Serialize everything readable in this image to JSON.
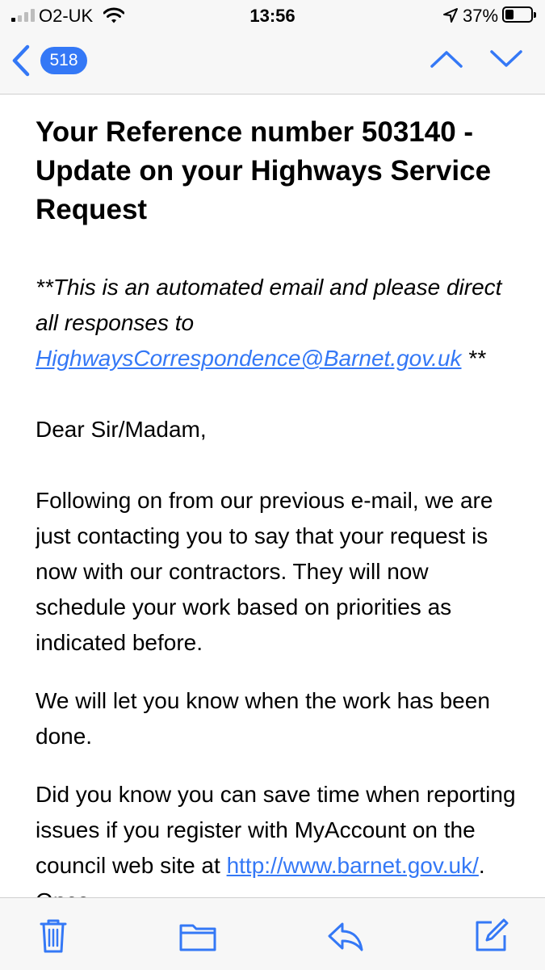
{
  "status_bar": {
    "carrier": "O2-UK",
    "time": "13:56",
    "battery_percent": "37%",
    "signal_bars_active": 1,
    "signal_bars_total": 4,
    "battery_level": 0.37
  },
  "nav": {
    "back_count": "518"
  },
  "email": {
    "subject": "Your Reference number 503140 - Update on your Highways Service Request",
    "notice_prefix": "**This is an automated email and please direct all responses to ",
    "notice_link": "HighwaysCorrespondence@Barnet.gov.uk",
    "notice_suffix": " **",
    "salutation": "Dear Sir/Madam,",
    "paragraph1": "Following on from our previous e-mail, we are just contacting you to say that your request is now with our contractors. They will now schedule your work based on priorities as indicated before.",
    "paragraph2": "We will let you know when the work has been done.",
    "paragraph3_text": "Did you know you can save time when reporting issues if you register with MyAccount on the council web site at ",
    "paragraph3_link": "http://www.barnet.gov.uk/",
    "paragraph3_suffix": ". Once"
  },
  "colors": {
    "accent": "#3478f6",
    "bar_background": "#f7f7f7"
  },
  "toolbar": {
    "icons": [
      "trash-icon",
      "folder-icon",
      "reply-icon",
      "compose-icon"
    ]
  }
}
